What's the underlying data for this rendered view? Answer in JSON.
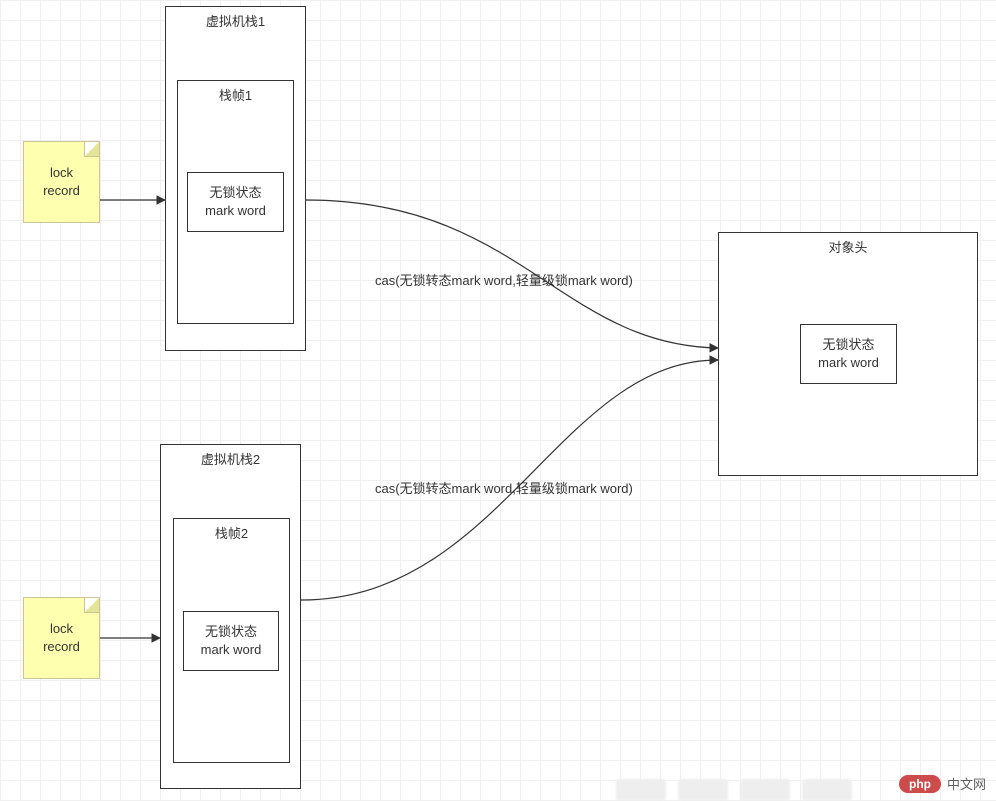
{
  "vmStack1": {
    "title": "虚拟机栈1"
  },
  "frame1": {
    "title": "栈帧1",
    "state_line1": "无锁状态",
    "state_line2": "mark word"
  },
  "vmStack2": {
    "title": "虚拟机栈2"
  },
  "frame2": {
    "title": "栈帧2",
    "state_line1": "无锁状态",
    "state_line2": "mark word"
  },
  "note1": {
    "line1": "lock",
    "line2": "record"
  },
  "note2": {
    "line1": "lock",
    "line2": "record"
  },
  "objectHeader": {
    "title": "对象头",
    "state_line1": "无锁状态",
    "state_line2": "mark word"
  },
  "edgeLabel1": "cas(无锁转态mark word,轻量级锁mark word)",
  "edgeLabel2": "cas(无锁转态mark word,轻量级锁mark word)",
  "watermark": {
    "badge": "php",
    "text": "中文网"
  }
}
